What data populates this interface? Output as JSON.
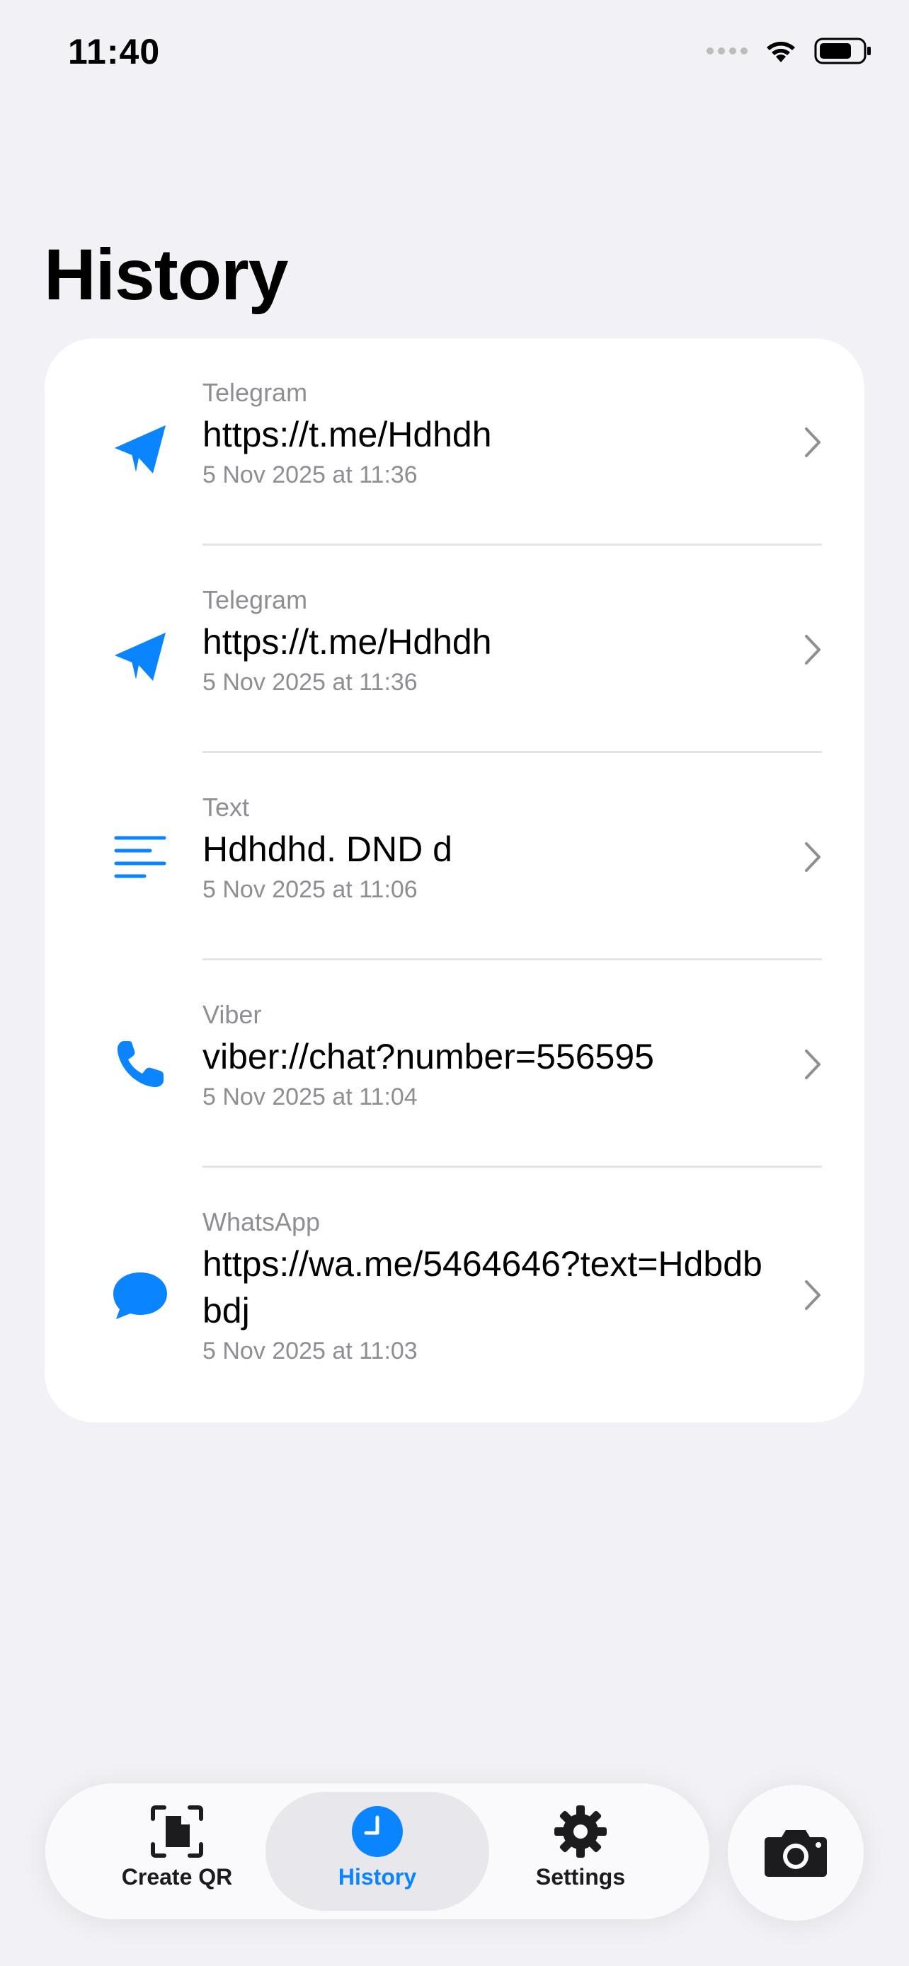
{
  "status_bar": {
    "time": "11:40"
  },
  "page": {
    "title": "History"
  },
  "history": [
    {
      "type": "Telegram",
      "value": "https://t.me/Hdhdh",
      "date": "5 Nov 2025 at 11:36",
      "icon": "telegram-paperplane-icon"
    },
    {
      "type": "Telegram",
      "value": "https://t.me/Hdhdh",
      "date": "5 Nov 2025 at 11:36",
      "icon": "telegram-paperplane-icon"
    },
    {
      "type": "Text",
      "value": "Hdhdhd. DND d",
      "date": "5 Nov 2025 at 11:06",
      "icon": "text-lines-icon"
    },
    {
      "type": "Viber",
      "value": "viber://chat?number=556595",
      "date": "5 Nov 2025 at 11:04",
      "icon": "phone-icon"
    },
    {
      "type": "WhatsApp",
      "value": "https://wa.me/5464646?text=Hdbdbbdj",
      "date": "5 Nov 2025 at 11:03",
      "icon": "message-bubble-icon"
    }
  ],
  "tab_bar": {
    "tabs": [
      {
        "label": "Create QR",
        "icon": "qr-document-scan-icon",
        "active": false
      },
      {
        "label": "History",
        "icon": "clock-icon",
        "active": true
      },
      {
        "label": "Settings",
        "icon": "gear-icon",
        "active": false
      }
    ],
    "camera_icon": "camera-icon"
  },
  "colors": {
    "accent": "#0A84FF",
    "background": "#F1F1F6",
    "secondary_text": "#8E8E93"
  }
}
